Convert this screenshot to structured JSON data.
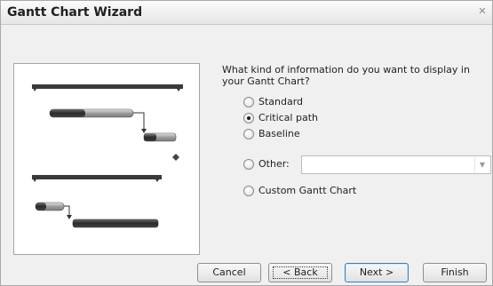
{
  "window": {
    "title": "Gantt Chart Wizard",
    "close_glyph": "✕"
  },
  "question": "What kind of information do you want to display in your Gantt Chart?",
  "options": [
    {
      "label": "Standard",
      "selected": false
    },
    {
      "label": "Critical path",
      "selected": true
    },
    {
      "label": "Baseline",
      "selected": false
    },
    {
      "label": "Other:",
      "selected": false
    },
    {
      "label": "Custom Gantt Chart",
      "selected": false
    }
  ],
  "other_combo": {
    "value": "",
    "arrow_glyph": "▼"
  },
  "buttons": {
    "cancel": "Cancel",
    "back": "< Back",
    "next": "Next >",
    "finish": "Finish"
  },
  "colors": {
    "dialog_bg": "#f0f0f0",
    "bar_dark": "#303030",
    "bar_light": "#a8a8a8"
  }
}
